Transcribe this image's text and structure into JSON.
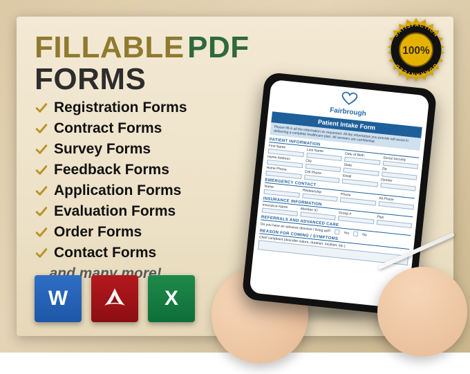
{
  "headline": {
    "word1": "FILLABLE",
    "word2": "PDF",
    "line2": "FORMS"
  },
  "list": [
    "Registration Forms",
    "Contract Forms",
    "Survey Forms",
    "Feedback Forms",
    "Application Forms",
    "Evaluation Forms",
    "Order Forms",
    "Contact Forms"
  ],
  "more_text": "...and many more!",
  "apps": {
    "word": "W",
    "acrobat": "A",
    "excel": "X"
  },
  "badge": {
    "top": "SATISFACTION",
    "center": "100%",
    "bottom": "GUARANTEED"
  },
  "form": {
    "brand": "Fairbrough",
    "title": "Patient Intake Form",
    "note": "Please fill in all the information as requested. All the information you provide will assist in delivering a complete healthcare plan. All answers are confidential.",
    "sections": {
      "patient": "PATIENT INFORMATION",
      "emergency": "EMERGENCY CONTACT",
      "insurance": "INSURANCE INFORMATION",
      "referrals": "REFERRALS AND ADVANCED CARE",
      "reason": "REASON FOR COMING / SYMPTOMS"
    },
    "labels": {
      "first_name": "First Name",
      "last_name": "Last Name",
      "dob": "Date of Birth",
      "ssn": "Social Security",
      "address": "Home Address",
      "city": "City",
      "state": "State",
      "zip": "Zip",
      "home_phone": "Home Phone",
      "cell_phone": "Cell Phone",
      "email": "Email",
      "gender": "Gender",
      "name": "Name",
      "relation": "Relationship",
      "phone": "Phone",
      "alt_phone": "Alt Phone",
      "ins_name": "Insurance Name",
      "member_id": "Member ID",
      "group": "Group #",
      "plan": "Plan",
      "adv_q": "Do you have an advance directive / living will?",
      "yes": "Yes",
      "no": "No",
      "reason_prompt": "Chief complaint (describe nature, duration, location, etc.)"
    }
  }
}
